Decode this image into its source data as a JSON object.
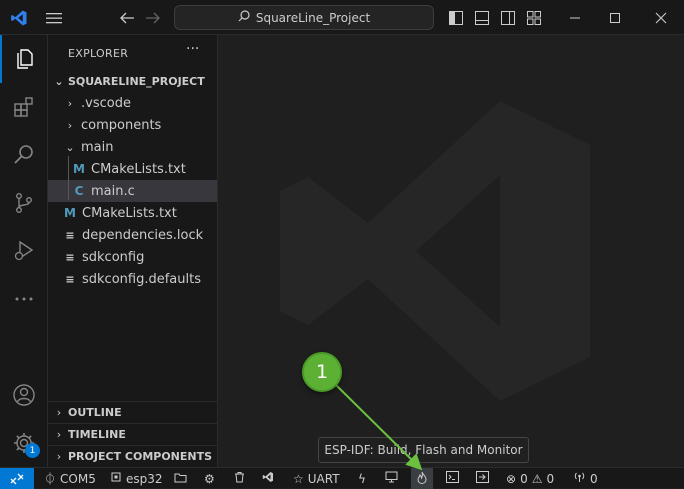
{
  "titlebar": {
    "search_text": "SquareLine_Project"
  },
  "explorer": {
    "header": "EXPLORER",
    "more": "···",
    "project": "SQUARELINE_PROJECT",
    "items": [
      {
        "label": ".vscode",
        "kind": "folder"
      },
      {
        "label": "components",
        "kind": "folder"
      },
      {
        "label": "main",
        "kind": "folder-open"
      },
      {
        "label": "CMakeLists.txt",
        "kind": "m-file"
      },
      {
        "label": "main.c",
        "kind": "c-file"
      },
      {
        "label": "CMakeLists.txt",
        "kind": "m-file"
      },
      {
        "label": "dependencies.lock",
        "kind": "text-file"
      },
      {
        "label": "sdkconfig",
        "kind": "text-file"
      },
      {
        "label": "sdkconfig.defaults",
        "kind": "text-file"
      }
    ],
    "file_badges": {
      "m": "M",
      "c": "C"
    },
    "sections": [
      "OUTLINE",
      "TIMELINE",
      "PROJECT COMPONENTS"
    ]
  },
  "activity": {
    "accounts_badge": "1"
  },
  "statusbar": {
    "port": "COM5",
    "target": "esp32",
    "flash_mode": "UART",
    "errors": "0",
    "warnings": "0",
    "ports": "0"
  },
  "tooltip": "ESP-IDF: Build, Flash and Monitor",
  "annotation": {
    "step_number": "1"
  },
  "colors": {
    "accent": "#0078d4",
    "annotation_green": "#5cb033",
    "selection": "#37373d"
  }
}
